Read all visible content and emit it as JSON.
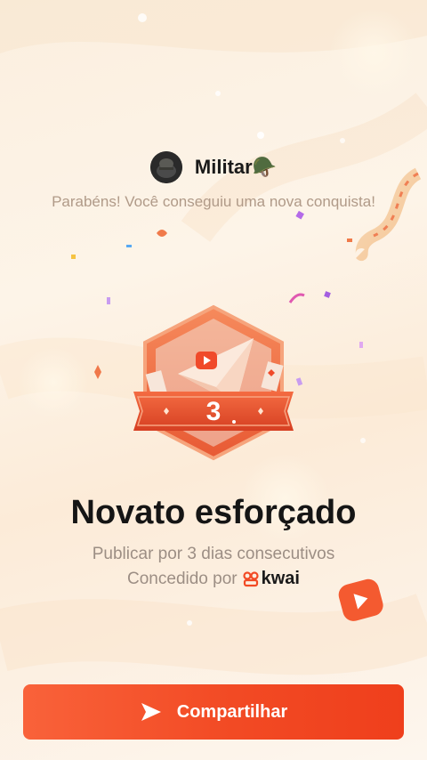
{
  "user": {
    "name": "Militar🪖",
    "avatar_icon": "avatar-icon"
  },
  "congrats_text": "Parabéns! Você conseguiu uma nova conquista!",
  "badge": {
    "number": "3",
    "icon": "paper-plane-play-badge-icon"
  },
  "achievement": {
    "title": "Novato esforçado",
    "description": "Publicar por 3 dias consecutivos",
    "awarded_by_label": "Concedido por",
    "awarded_by_brand": "kwai"
  },
  "share_button": {
    "label": "Compartilhar",
    "icon": "send-arrow-icon"
  },
  "colors": {
    "accent": "#f24a24",
    "badge_orange": "#f06a3c",
    "badge_red": "#e0452a"
  }
}
